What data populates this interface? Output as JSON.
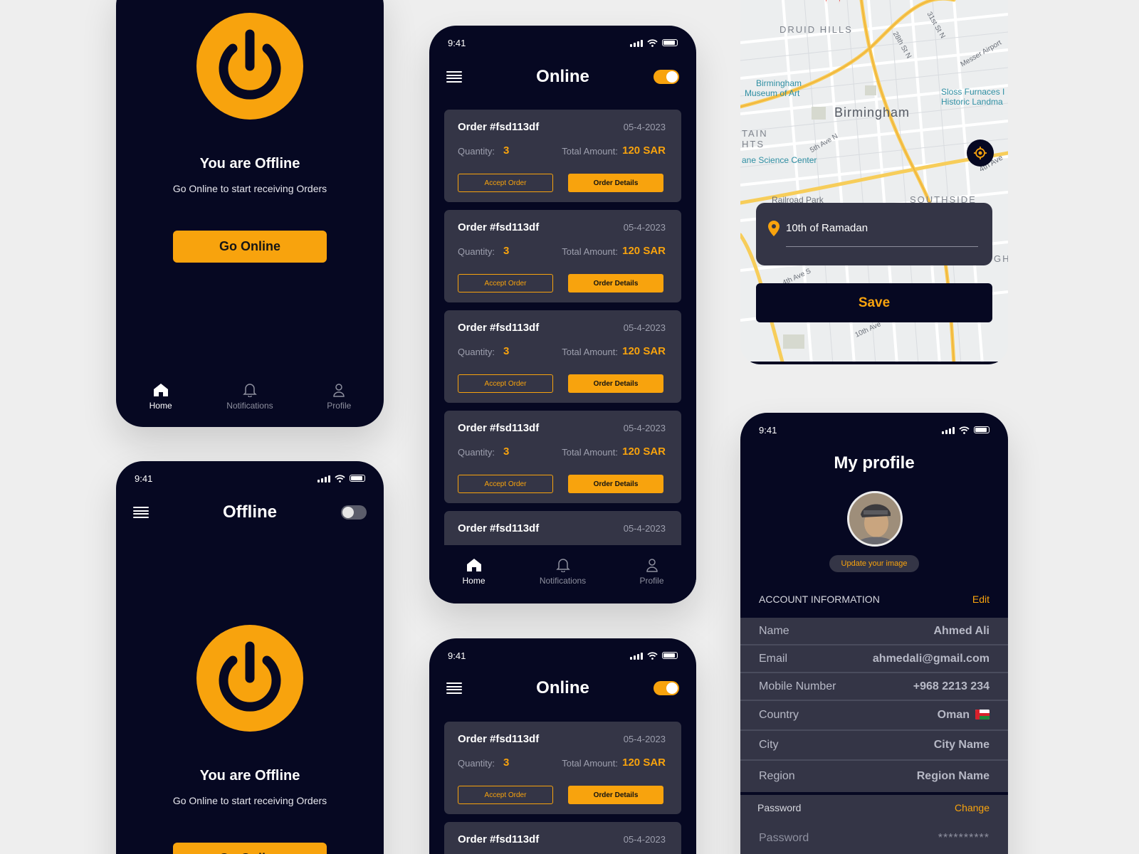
{
  "status": {
    "time": "9:41"
  },
  "offline": {
    "title": "You are Offline",
    "subtitle": "Go Online to start receiving Orders",
    "button": "Go Online",
    "appbar_title": "Offline"
  },
  "online": {
    "appbar_title": "Online"
  },
  "nav": {
    "home": "Home",
    "notifications": "Notifications",
    "profile": "Profile"
  },
  "order": {
    "id": "Order #fsd113df",
    "date": "05-4-2023",
    "quantity_label": "Quantity:",
    "quantity": "3",
    "total_label": "Total Amount:",
    "total": "120 SAR",
    "accept": "Accept Order",
    "details": "Order Details"
  },
  "map": {
    "labels": {
      "druid_hills": "DRUID HILLS",
      "birmingham_museum_1": "Birmingham",
      "birmingham_museum_2": "Museum of Art",
      "sloss_1": "Sloss Furnaces I",
      "sloss_2": "Historic Landma",
      "birmingham": "Birmingham",
      "tain": "TAIN",
      "hts": "HTS",
      "science_center": "ane Science Center",
      "railroad_park": "Railroad Park",
      "southside": "SOUTHSIDE",
      "fifth_ave_n": "5th Ave N",
      "fourth_ave": "4th Ave",
      "tenth_ave": "10th Ave",
      "fourth_ave_s": "4th Ave S",
      "messer_airport": "Messer Airport",
      "st_28": "28th St N",
      "st_31": "31st St N",
      "gh": "GH"
    },
    "location": "10th of Ramadan",
    "save": "Save"
  },
  "profile": {
    "title": "My profile",
    "update_image": "Update your image",
    "account_header": "ACCOUNT INFORMATION",
    "edit": "Edit",
    "rows": [
      {
        "label": "Name",
        "value": "Ahmed Ali"
      },
      {
        "label": "Email",
        "value": "ahmedali@gmail.com"
      },
      {
        "label": "Mobile Number",
        "value": "+968 2213 234"
      },
      {
        "label": "Country",
        "value": "Oman"
      },
      {
        "label": "City",
        "value": "City Name"
      },
      {
        "label": "Region",
        "value": "Region Name"
      }
    ],
    "password_label": "Password",
    "change": "Change",
    "password_field_label": "Password",
    "password_mask": "**********"
  },
  "colors": {
    "accent": "#f8a30d",
    "background": "#060822",
    "card": "#343546",
    "page": "#eeeeee"
  }
}
